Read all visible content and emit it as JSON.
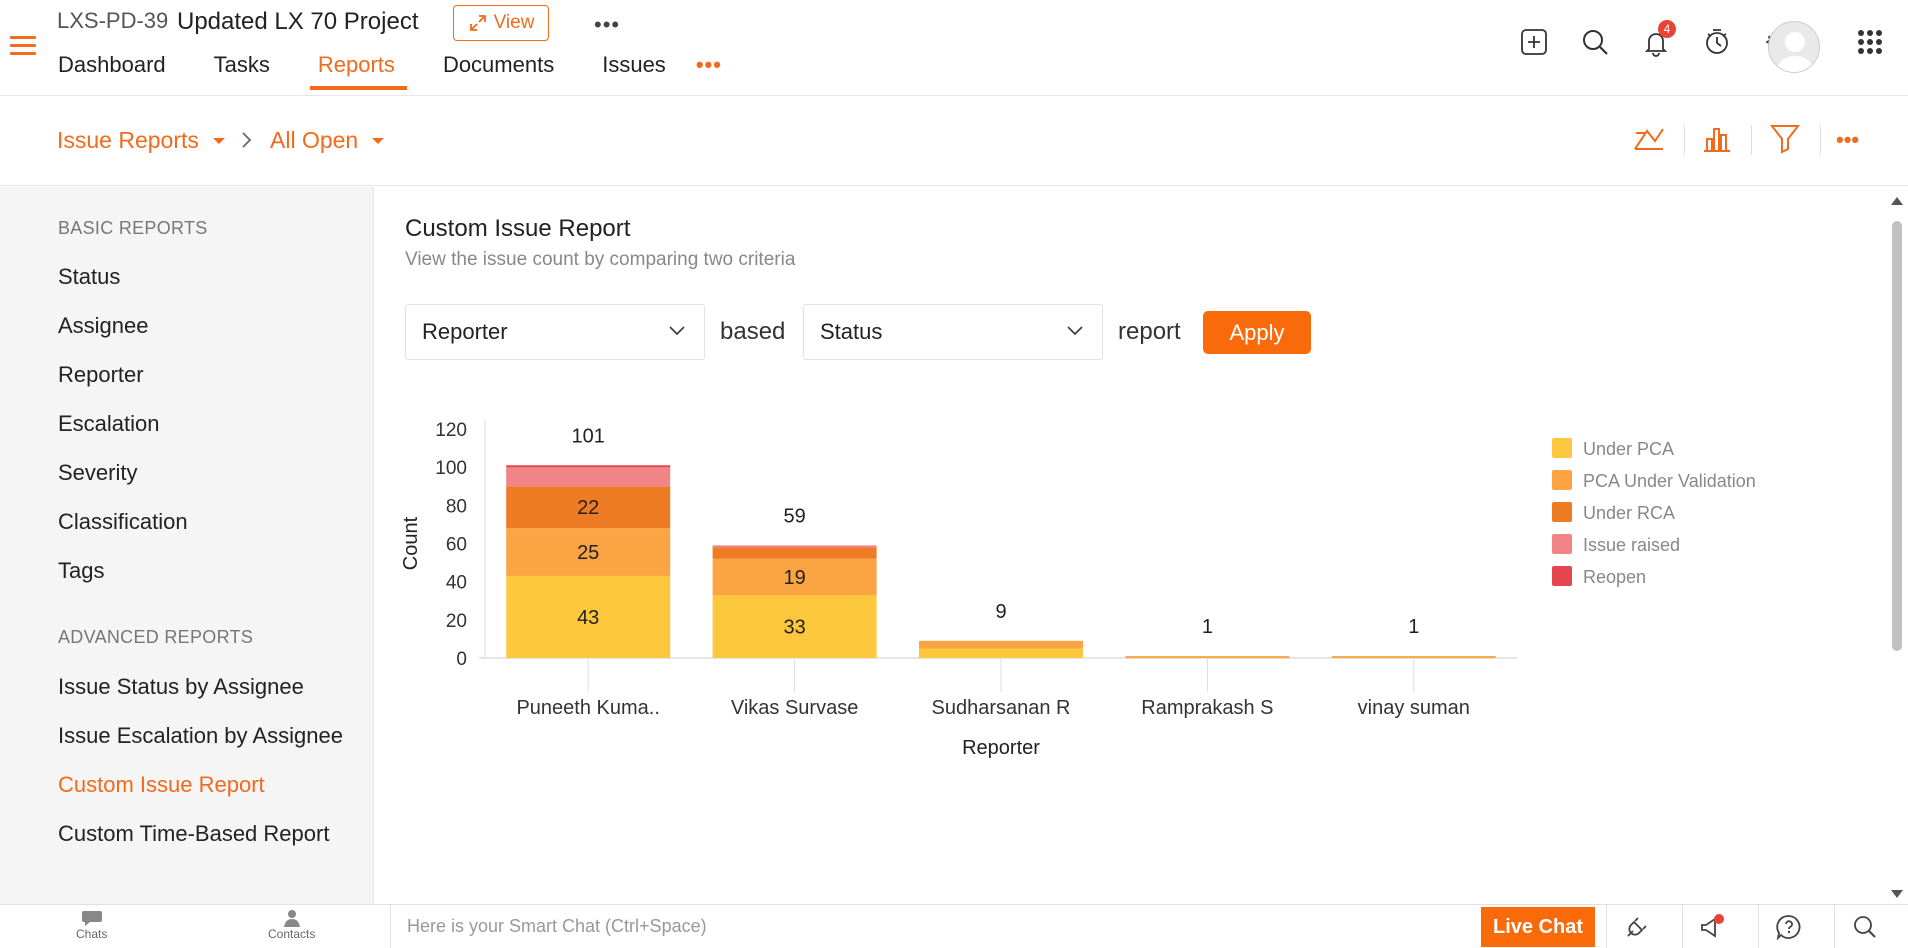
{
  "header": {
    "project_id": "LXS-PD-39",
    "project_name": "Updated LX 70 Project",
    "view_label": "View",
    "tabs": [
      {
        "label": "Dashboard"
      },
      {
        "label": "Tasks"
      },
      {
        "label": "Reports",
        "active": true
      },
      {
        "label": "Documents"
      },
      {
        "label": "Issues"
      }
    ],
    "notification_count": "4"
  },
  "breadcrumb": {
    "reports_type": "Issue Reports",
    "filter": "All Open"
  },
  "sidebar": {
    "basic_heading": "BASIC REPORTS",
    "basic_items": [
      "Status",
      "Assignee",
      "Reporter",
      "Escalation",
      "Severity",
      "Classification",
      "Tags"
    ],
    "advanced_heading": "ADVANCED REPORTS",
    "advanced_items": [
      "Issue Status by Assignee",
      "Issue Escalation by Assignee",
      "Custom Issue Report",
      "Custom Time-Based Report"
    ],
    "active_item": "Custom Issue Report"
  },
  "report": {
    "title": "Custom Issue Report",
    "subtitle": "View the issue count by comparing two criteria",
    "criteria1": "Reporter",
    "based_word": "based",
    "criteria2": "Status",
    "report_word": "report",
    "apply_label": "Apply"
  },
  "chart_data": {
    "type": "bar",
    "stacked": true,
    "categories": [
      "Puneeth Kuma..",
      "Vikas Survase",
      "Sudharsanan R",
      "Ramprakash S",
      "vinay suman"
    ],
    "totals": [
      101,
      59,
      9,
      1,
      1
    ],
    "series": [
      {
        "name": "Under PCA",
        "color": "#fdc73e",
        "values": [
          43,
          33,
          5,
          0,
          0
        ]
      },
      {
        "name": "PCA Under Validation",
        "color": "#fba443",
        "values": [
          25,
          19,
          4,
          1,
          1
        ]
      },
      {
        "name": "Under RCA",
        "color": "#ee7c24",
        "values": [
          22,
          6,
          0,
          0,
          0
        ]
      },
      {
        "name": "Issue raised",
        "color": "#f08486",
        "values": [
          10,
          1,
          0,
          0,
          0
        ]
      },
      {
        "name": "Reopen",
        "color": "#e5454f",
        "values": [
          1,
          0,
          0,
          0,
          0
        ]
      }
    ],
    "segment_labels_shown": [
      {
        "category": 0,
        "series": 0,
        "label": "43"
      },
      {
        "category": 0,
        "series": 1,
        "label": "25"
      },
      {
        "category": 0,
        "series": 2,
        "label": "22"
      },
      {
        "category": 1,
        "series": 0,
        "label": "33"
      },
      {
        "category": 1,
        "series": 1,
        "label": "19"
      }
    ],
    "xlabel": "Reporter",
    "ylabel": "Count",
    "ylim": [
      0,
      120
    ],
    "yticks": [
      0,
      20,
      40,
      60,
      80,
      100,
      120
    ],
    "legend_position": "top-right"
  },
  "bottombar": {
    "chats_label": "Chats",
    "contacts_label": "Contacts",
    "smart_chat_placeholder": "Here is your Smart Chat (Ctrl+Space)",
    "live_chat_label": "Live Chat"
  }
}
